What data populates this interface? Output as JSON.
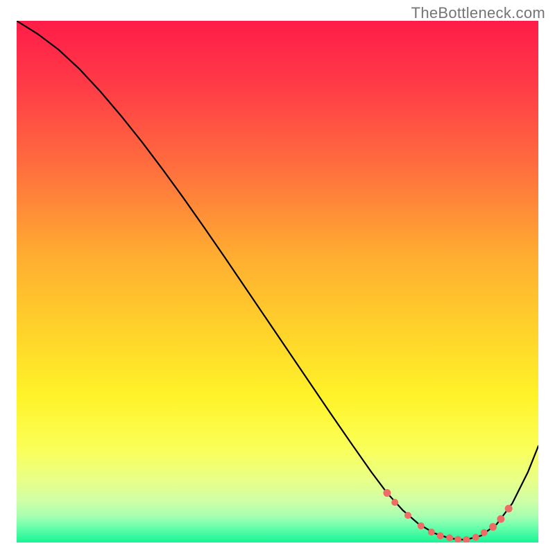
{
  "watermark": "TheBottleneck.com",
  "colors": {
    "curve": "#000000",
    "marker": "#ee6b66"
  },
  "chart_data": {
    "type": "line",
    "title": "",
    "xlabel": "",
    "ylabel": "",
    "xlim": [
      0,
      100
    ],
    "ylim": [
      0,
      100
    ],
    "grid": false,
    "legend": false,
    "series": [
      {
        "name": "bottleneck-curve",
        "x": [
          0,
          4,
          8,
          12,
          16,
          20,
          24,
          28,
          32,
          36,
          40,
          44,
          48,
          52,
          56,
          60,
          64,
          68,
          71,
          74,
          77,
          80,
          83,
          86,
          89,
          92,
          95,
          98,
          100
        ],
        "y": [
          100,
          97.5,
          94.5,
          90.8,
          86.5,
          81.8,
          76.8,
          71.5,
          66,
          60.3,
          54.5,
          48.6,
          42.7,
          36.8,
          30.9,
          25,
          19.2,
          13.5,
          9.5,
          6.2,
          3.6,
          1.8,
          0.8,
          0.5,
          1.3,
          3.5,
          7.5,
          13.5,
          18.5
        ]
      }
    ],
    "markers": {
      "name": "highlight-dots",
      "color": "#ee6b66",
      "points": [
        {
          "x": 71.0,
          "y": 9.5,
          "r": 5.5
        },
        {
          "x": 72.5,
          "y": 7.7,
          "r": 5.0
        },
        {
          "x": 75.0,
          "y": 5.2,
          "r": 5.0
        },
        {
          "x": 77.5,
          "y": 3.2,
          "r": 5.0
        },
        {
          "x": 79.5,
          "y": 2.0,
          "r": 5.0
        },
        {
          "x": 81.2,
          "y": 1.3,
          "r": 5.0
        },
        {
          "x": 83.0,
          "y": 0.9,
          "r": 5.0
        },
        {
          "x": 84.6,
          "y": 0.6,
          "r": 5.0
        },
        {
          "x": 86.2,
          "y": 0.55,
          "r": 5.0
        },
        {
          "x": 88.0,
          "y": 1.0,
          "r": 5.0
        },
        {
          "x": 89.6,
          "y": 1.9,
          "r": 5.0
        },
        {
          "x": 91.3,
          "y": 3.0,
          "r": 5.5
        },
        {
          "x": 92.8,
          "y": 4.5,
          "r": 5.5
        },
        {
          "x": 94.3,
          "y": 6.5,
          "r": 5.5
        }
      ]
    }
  }
}
